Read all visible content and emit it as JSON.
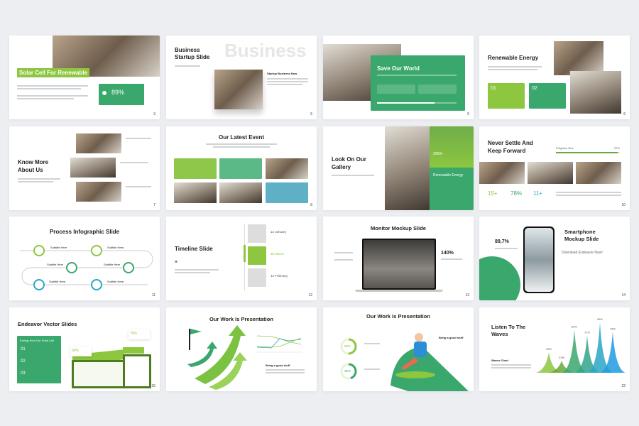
{
  "colors": {
    "green": "#3aa76d",
    "lime": "#8dc63f",
    "teal": "#2aa6c4",
    "background": "#eceef2"
  },
  "slides": [
    {
      "title": "Solar Cell For Renewable",
      "stat": "89%",
      "page": "3"
    },
    {
      "title_line1": "Business",
      "title_line2": "Startup Slide",
      "watermark": "Business",
      "side_title": "Startup Business New",
      "page": "5"
    },
    {
      "title": "Save Our World",
      "progress": 72,
      "page": "5"
    },
    {
      "title": "Renewable Energy",
      "boxes": [
        "01",
        "02"
      ],
      "page": "6"
    },
    {
      "title_line1": "Know More",
      "title_line2": "About Us",
      "page": "7"
    },
    {
      "title": "Our Latest Event",
      "page": "8"
    },
    {
      "title_line1": "Look On Our",
      "title_line2": "Gallery",
      "panel_title": "Renewable Energy",
      "panel_stat": "2000+"
    },
    {
      "title_line1": "Never Settle And",
      "title_line2": "Keep Forward",
      "progress_label": "Progress One",
      "progress_value": "97%",
      "progress": 97,
      "stats": [
        "15+",
        "78%",
        "11+"
      ],
      "page": "10"
    },
    {
      "title": "Process Infographic Slide",
      "subtitles": [
        "Subtitle Here",
        "Subtitle Here",
        "Subtitle Here",
        "Subtitle Here",
        "Subtitle Here",
        "Subtitle Here"
      ],
      "page": "11"
    },
    {
      "title": "Timeline Slide",
      "quote": "“",
      "events": [
        {
          "date": "12 January"
        },
        {
          "date": "30 March"
        },
        {
          "date": "14 February"
        }
      ],
      "page": "12"
    },
    {
      "title": "Monitor Mockup Slide",
      "stat": "140%",
      "page": "13"
    },
    {
      "title_line1": "Smartphone",
      "title_line2": "Mockup Slide",
      "cta": "Download Endeavor Now!",
      "stat": "89,7%",
      "page": "14"
    },
    {
      "title": "Endeavor Vector Slides",
      "panel_title": "Energy from Our Solar Cell",
      "items": [
        "01",
        "02",
        "03"
      ],
      "badges": [
        "79%",
        "69%"
      ],
      "page": "15"
    },
    {
      "title": "Our Work Is Presentation",
      "side_title": "Bring a good stuff"
    },
    {
      "title": "Our Work Is Presentation",
      "rings": [
        "50%",
        "45%"
      ],
      "side_title": "Bring a good stuff",
      "ring_values": [
        50,
        45
      ]
    },
    {
      "title_line1": "Listen To The",
      "title_line2": "Waves",
      "chart_title": "Waves Chart",
      "page": "22"
    }
  ],
  "chart_data": {
    "type": "area",
    "title": "Waves Chart",
    "values": [
      39,
      23,
      82,
      71,
      96,
      78
    ],
    "labels": [
      "39%",
      "23%",
      "82%",
      "71%",
      "96%",
      "78%"
    ],
    "colors": [
      "#8dc63f",
      "#6aa83a",
      "#3aa76d",
      "#33a58a",
      "#2aa6c4",
      "#1e9be0"
    ]
  }
}
